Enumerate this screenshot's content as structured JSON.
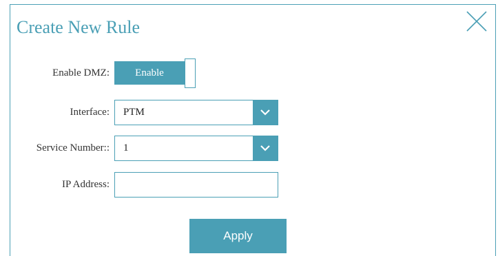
{
  "dialog": {
    "title": "Create New Rule",
    "close_icon": "close-icon"
  },
  "form": {
    "enable_dmz": {
      "label": "Enable DMZ:",
      "toggle_text": "Enable",
      "state": "on"
    },
    "interface": {
      "label": "Interface:",
      "value": "PTM",
      "icon": "chevron-down-icon"
    },
    "service_number": {
      "label": "Service Number::",
      "value": "1",
      "icon": "chevron-down-icon"
    },
    "ip_address": {
      "label": "IP Address:",
      "value": "",
      "placeholder": ""
    }
  },
  "actions": {
    "apply_label": "Apply"
  },
  "colors": {
    "accent": "#4a9fb5",
    "text": "#333333",
    "background": "#ffffff"
  }
}
